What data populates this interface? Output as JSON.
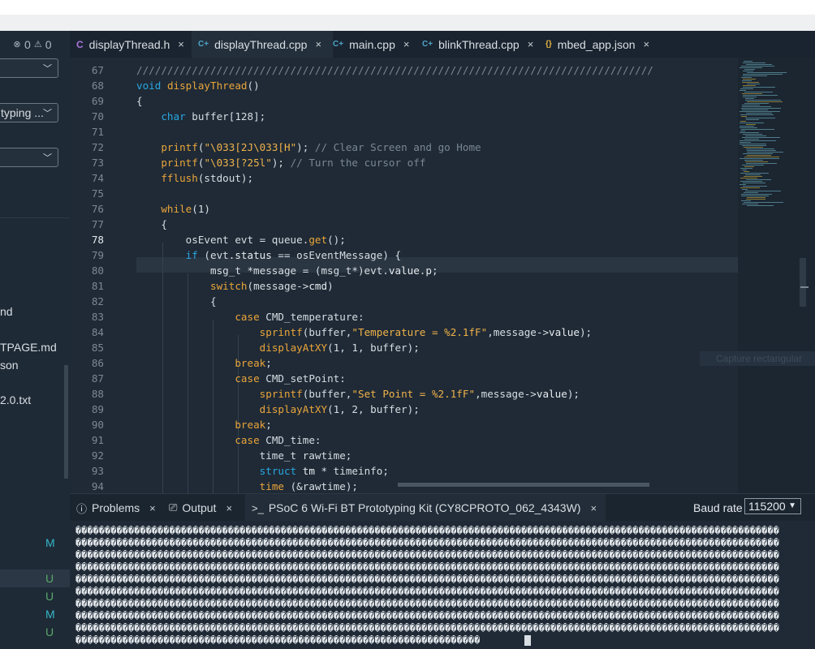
{
  "status": {
    "errors": "0",
    "warnings": "0"
  },
  "sidebar": {
    "selects": [
      {
        "text": ""
      },
      {
        "text": "typing ..."
      },
      {
        "text": ""
      }
    ],
    "files": [
      {
        "name": "nd",
        "status": ""
      },
      {
        "name": "TPAGE.md",
        "status": ""
      },
      {
        "name": "son",
        "status": ""
      },
      {
        "name": "2.0.txt",
        "status": ""
      }
    ],
    "git_marks": [
      "M",
      "U",
      "U",
      "M",
      "U"
    ]
  },
  "tabs": [
    {
      "icon": "C",
      "label": "displayThread.h",
      "close": "×",
      "active": false
    },
    {
      "icon": "C+",
      "label": "displayThread.cpp",
      "close": "×",
      "active": true
    },
    {
      "icon": "C+",
      "label": "main.cpp",
      "close": "×",
      "active": false
    },
    {
      "icon": "C+",
      "label": "blinkThread.cpp",
      "close": "×",
      "active": false
    },
    {
      "icon": "{}",
      "label": "mbed_app.json",
      "close": "×",
      "active": false
    }
  ],
  "editor": {
    "current_line": "78",
    "line_numbers": [
      "67",
      "68",
      "69",
      "70",
      "71",
      "72",
      "73",
      "74",
      "75",
      "76",
      "77",
      "78",
      "79",
      "80",
      "81",
      "82",
      "83",
      "84",
      "85",
      "86",
      "87",
      "88",
      "89",
      "90",
      "91",
      "92",
      "93",
      "94"
    ]
  },
  "minimap_ghost": "Capture rectangular",
  "panel": {
    "tabs": [
      {
        "icon": "ⓘ",
        "label": "Problems",
        "close": "×"
      },
      {
        "icon": "⎚",
        "label": "Output",
        "close": "×"
      },
      {
        "icon": ">_",
        "label": "PSoC 6 Wi-Fi BT Prototyping Kit (CY8CPROTO_062_4343W)",
        "close": "×"
      }
    ],
    "baud_label": "Baud rate",
    "baud_value": "115200",
    "terminal_glyph": "�"
  },
  "colors": {
    "keyword": "#29a7e0",
    "function": "#eaa53a",
    "comment": "#7a8794",
    "git_modified": "#34b8c8",
    "git_untracked": "#5aa86b"
  }
}
